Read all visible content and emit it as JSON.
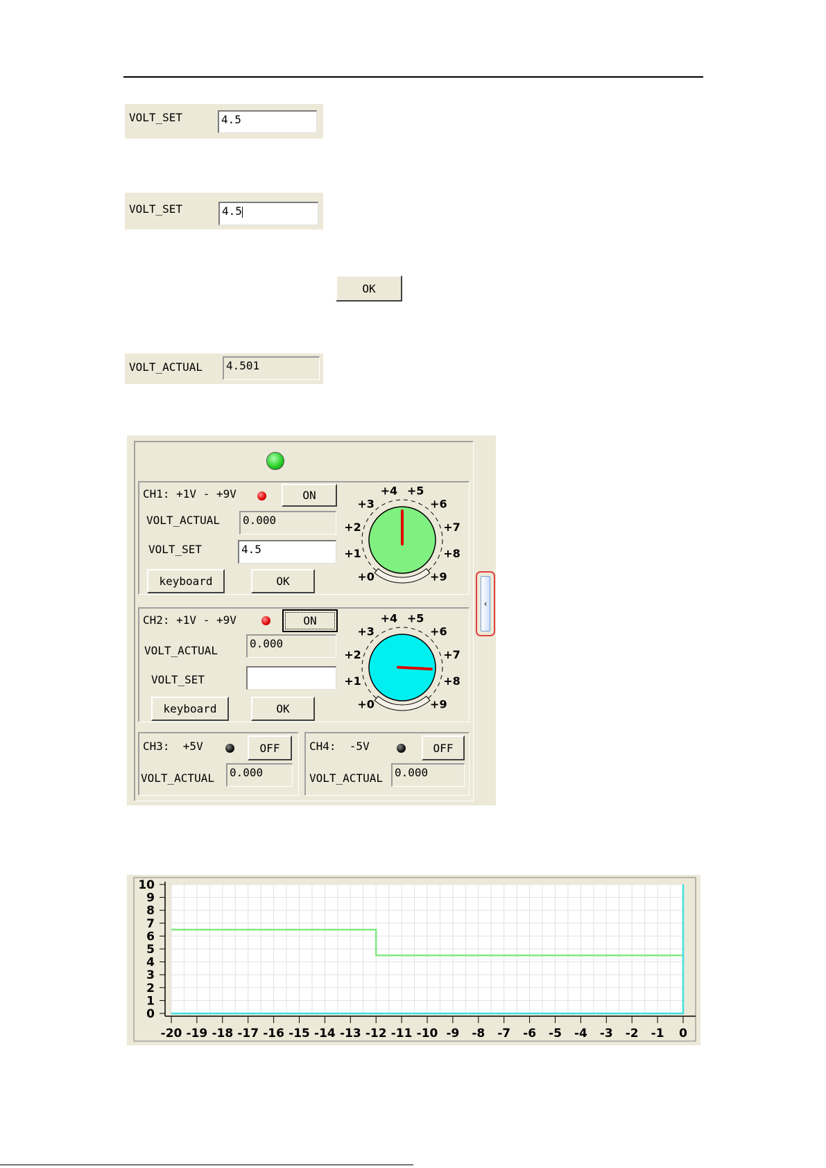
{
  "snippet1": {
    "label": "VOLT_SET",
    "value": "4.5"
  },
  "snippet2": {
    "label": "VOLT_SET",
    "value": "4.5"
  },
  "snippet3": {
    "button": "OK"
  },
  "snippet4": {
    "label": "VOLT_ACTUAL",
    "value": "4.501"
  },
  "panel": {
    "ch1": {
      "title": "CH1: +1V - +9V",
      "toggle": "ON",
      "actual_label": "VOLT_ACTUAL",
      "actual_value": "0.000",
      "set_label": "VOLT_SET",
      "set_value": "4.5",
      "keyboard": "keyboard",
      "ok": "OK",
      "knob_color": "#80f080",
      "knob_value": 4.5
    },
    "ch2": {
      "title": "CH2: +1V - +9V",
      "toggle": "ON",
      "actual_label": "VOLT_ACTUAL",
      "actual_value": "0.000",
      "set_label": "VOLT_SET",
      "set_value": "",
      "keyboard": "keyboard",
      "ok": "OK",
      "knob_color": "#00f0f0",
      "knob_value": 7.6
    },
    "ch3": {
      "title": "CH3:  +5V",
      "toggle": "OFF",
      "actual_label": "VOLT_ACTUAL",
      "actual_value": "0.000"
    },
    "ch4": {
      "title": "CH4:  -5V",
      "toggle": "OFF",
      "actual_label": "VOLT_ACTUAL",
      "actual_value": "0.000"
    },
    "dial_labels": [
      "+0",
      "+1",
      "+2",
      "+3",
      "+4",
      "+5",
      "+6",
      "+7",
      "+8",
      "+9"
    ],
    "colors": {
      "status_led": "#22cc22",
      "channel_led": "#e00000",
      "off_led": "#101010"
    },
    "collapse_icon": "chevron-left-icon"
  },
  "chart_data": {
    "type": "line",
    "x_ticks": [
      "-20",
      "-19",
      "-18",
      "-17",
      "-16",
      "-15",
      "-14",
      "-13",
      "-12",
      "-11",
      "-10",
      "-9",
      "-8",
      "-7",
      "-6",
      "-5",
      "-4",
      "-3",
      "-2",
      "-1",
      "0"
    ],
    "y_ticks": [
      "0",
      "1",
      "2",
      "3",
      "4",
      "5",
      "6",
      "7",
      "8",
      "9",
      "10"
    ],
    "xlim": [
      -20,
      0
    ],
    "ylim": [
      0,
      10
    ],
    "grid": true,
    "series": [
      {
        "color": "#80e880",
        "points": [
          [
            -20,
            6.5
          ],
          [
            -12,
            6.5
          ],
          [
            -12,
            4.5
          ],
          [
            0,
            4.5
          ]
        ]
      },
      {
        "color": "#40e0e0",
        "points": [
          [
            -20,
            0
          ],
          [
            0,
            0
          ],
          [
            0,
            10
          ]
        ]
      }
    ]
  }
}
